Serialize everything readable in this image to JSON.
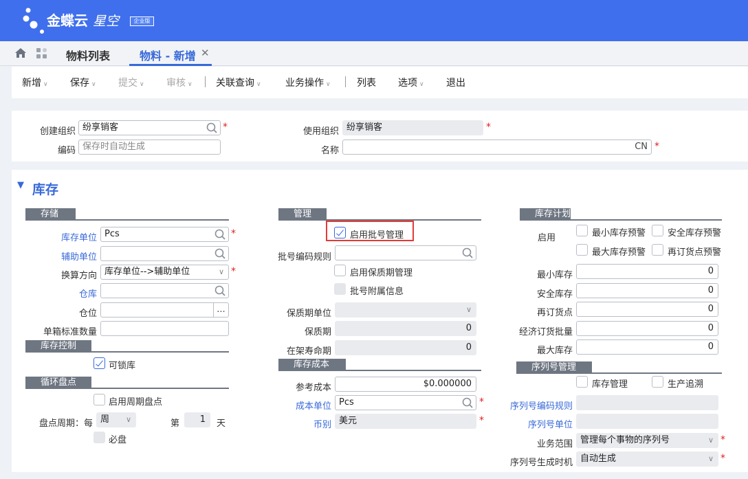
{
  "app": {
    "brand": "金蝶云",
    "brand2": "星空",
    "edition": "企业版"
  },
  "tabs": {
    "list": "物料列表",
    "active": "物料 - 新增"
  },
  "toolbar": {
    "add": "新增",
    "save": "保存",
    "submit": "提交",
    "audit": "审核",
    "related": "关联查询",
    "ops": "业务操作",
    "list": "列表",
    "options": "选项",
    "exit": "退出"
  },
  "header": {
    "create_org_label": "创建组织",
    "create_org_value": "纷享销客",
    "code_label": "编码",
    "code_placeholder": "保存时自动生成",
    "use_org_label": "使用组织",
    "use_org_value": "纷享销客",
    "name_label": "名称",
    "name_lang": "CN"
  },
  "section": {
    "title": "库存"
  },
  "storage": {
    "title": "存储",
    "unit_label": "库存单位",
    "unit_value": "Pcs",
    "aux_unit_label": "辅助单位",
    "convert_label": "换算方向",
    "convert_value": "库存单位-->辅助单位",
    "warehouse_label": "仓库",
    "location_label": "仓位",
    "location_btn": "...",
    "box_qty_label": "单箱标准数量"
  },
  "stock_control": {
    "title": "库存控制",
    "lockable_label": "可锁库",
    "lockable": true
  },
  "cycle_count": {
    "title": "循环盘点",
    "enable_label": "启用周期盘点",
    "period_label": "盘点周期：每",
    "period_unit": "周",
    "nth_label": "第",
    "nth_value": "1",
    "day_label": "天",
    "must_label": "必盘"
  },
  "manage": {
    "title": "管理",
    "batch_label": "启用批号管理",
    "batch_enabled": true,
    "batch_rule_label": "批号编码规则",
    "shelf_label": "启用保质期管理",
    "batch_attach_label": "批号附属信息",
    "shelf_unit_label": "保质期单位",
    "shelf_period_label": "保质期",
    "shelf_period_value": "0",
    "shelf_life_label": "在架寿命期",
    "shelf_life_value": "0"
  },
  "cost": {
    "title": "库存成本",
    "ref_cost_label": "参考成本",
    "ref_cost_value": "$0.000000",
    "cost_unit_label": "成本单位",
    "cost_unit_value": "Pcs",
    "currency_label": "币别",
    "currency_value": "美元"
  },
  "plan": {
    "title": "库存计划",
    "enable_label": "启用",
    "min_warn": "最小库存预警",
    "safe_warn": "安全库存预警",
    "max_warn": "最大库存预警",
    "reorder_warn": "再订货点预警",
    "min_stock_label": "最小库存",
    "min_stock_value": "0",
    "safe_stock_label": "安全库存",
    "safe_stock_value": "0",
    "reorder_label": "再订货点",
    "reorder_value": "0",
    "eoq_label": "经济订货批量",
    "eoq_value": "0",
    "max_stock_label": "最大库存",
    "max_stock_value": "0"
  },
  "serial": {
    "title": "序列号管理",
    "stock_mgmt_label": "库存管理",
    "trace_label": "生产追溯",
    "rule_label": "序列号编码规则",
    "unit_label": "序列号单位",
    "scope_label": "业务范围",
    "scope_value": "管理每个事物的序列号",
    "gen_label": "序列号生成时机",
    "gen_value": "自动生成"
  },
  "colors": {
    "brand": "#3f6fec",
    "link": "#3869d9",
    "required": "#e02020",
    "highlight": "#e53935"
  }
}
